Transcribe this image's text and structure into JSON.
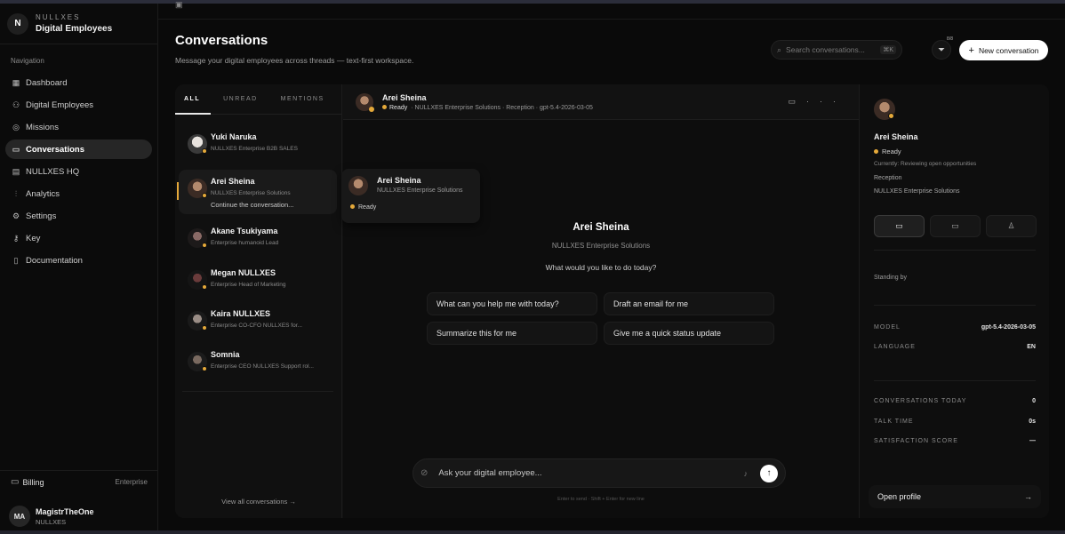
{
  "brand": {
    "top": "NULLXES",
    "name": "Digital Employees",
    "logo": "N"
  },
  "nav": {
    "heading": "Navigation",
    "items": [
      {
        "label": "Dashboard",
        "icon": "grid-icon",
        "glyph": "▦"
      },
      {
        "label": "Digital Employees",
        "icon": "users-icon",
        "glyph": "⚇"
      },
      {
        "label": "Missions",
        "icon": "target-icon",
        "glyph": "◎"
      },
      {
        "label": "Conversations",
        "icon": "chat-icon",
        "glyph": "▭"
      },
      {
        "label": "NULLXES HQ",
        "icon": "building-icon",
        "glyph": "▤"
      },
      {
        "label": "Analytics",
        "icon": "chart-icon",
        "glyph": "⫶"
      },
      {
        "label": "Settings",
        "icon": "gear-icon",
        "glyph": "⚙"
      },
      {
        "label": "Key",
        "icon": "key-icon",
        "glyph": "⚷"
      },
      {
        "label": "Documentation",
        "icon": "doc-icon",
        "glyph": "▯"
      }
    ],
    "active": "Conversations"
  },
  "billing": {
    "label": "Billing",
    "tier": "Enterprise"
  },
  "user": {
    "initials": "MA",
    "name": "MagistrTheOne",
    "org": "NULLXES"
  },
  "page": {
    "title": "Conversations",
    "subtitle": "Message your digital employees across threads — text-first workspace."
  },
  "search": {
    "placeholder": "Search conversations...",
    "kbd": "⌘K"
  },
  "filter": {
    "badge": "8/8"
  },
  "new_conversation": "New conversation",
  "tabs": [
    "ALL",
    "UNREAD",
    "MENTIONS"
  ],
  "conversations": [
    {
      "name": "Yuki Naruka",
      "role": "NULLXES Enterprise B2B SALES",
      "preview": ""
    },
    {
      "name": "Arei Sheina",
      "role": "NULLXES Enterprise Solutions",
      "preview": "Continue the conversation..."
    },
    {
      "name": "Akane Tsukiyama",
      "role": "Enterprise humanoid Lead",
      "preview": ""
    },
    {
      "name": "Megan NULLXES",
      "role": "Enterprise Head of Marketing",
      "preview": ""
    },
    {
      "name": "Kaira NULLXES",
      "role": "Enterprise CO-CFO NULLXES for...",
      "preview": ""
    },
    {
      "name": "Somnia",
      "role": "Enterprise CEO NULLXES Support rol...",
      "preview": ""
    }
  ],
  "view_all": "View all conversations →",
  "chat": {
    "name": "Arei Sheina",
    "status": "Ready",
    "meta": "· NULLXES Enterprise Solutions · Reception · gpt-5.4-2026-03-05",
    "hover": {
      "name": "Arei Sheina",
      "role": "NULLXES Enterprise Solutions",
      "status": "Ready"
    },
    "center_name": "Arei Sheina",
    "center_org": "NULLXES Enterprise Solutions",
    "question": "What would you like to do today?",
    "suggestions": [
      "What can you help me with today?",
      "Draft an email for me",
      "Summarize this for me",
      "Give me a quick status update"
    ],
    "composer_placeholder": "Ask your digital employee...",
    "hint": "Enter to send · Shift + Enter for new line"
  },
  "profile": {
    "name": "Arei Sheina",
    "status": "Ready",
    "currently": "Currently: Reviewing open opportunities",
    "team": "Reception",
    "org": "NULLXES Enterprise Solutions",
    "standing": "Standing by",
    "stats": [
      {
        "label": "MODEL",
        "value": "gpt-5.4-2026-03-05"
      },
      {
        "label": "LANGUAGE",
        "value": "EN"
      },
      {
        "label": "CONVERSATIONS TODAY",
        "value": "0"
      },
      {
        "label": "TALK TIME",
        "value": "0s"
      },
      {
        "label": "SATISFACTION SCORE",
        "value": "—"
      }
    ],
    "open_profile": "Open profile"
  },
  "colors": {
    "accent": "#e5a93a",
    "background": "#0a0a0a",
    "panel": "#111111"
  }
}
